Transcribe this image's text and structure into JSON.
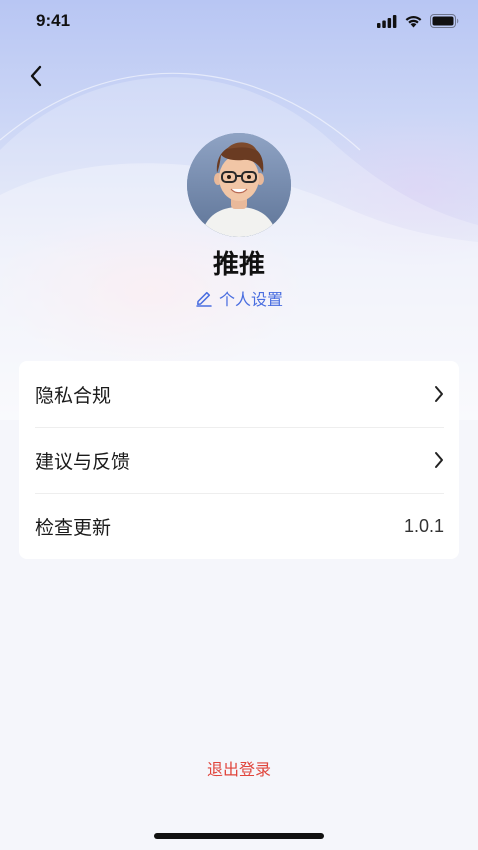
{
  "status_bar": {
    "time": "9:41",
    "icons": [
      "cellular-signal-icon",
      "wifi-icon",
      "battery-icon"
    ]
  },
  "header": {
    "back_icon": "chevron-left-icon"
  },
  "profile": {
    "nickname": "推推",
    "settings_link_label": "个人设置",
    "settings_link_icon": "pencil-edit-icon",
    "accent_color": "#4a6ee0"
  },
  "menu": {
    "items": [
      {
        "label": "隐私合规",
        "trailing_icon": "chevron-right-icon"
      },
      {
        "label": "建议与反馈",
        "trailing_icon": "chevron-right-icon"
      },
      {
        "label": "检查更新",
        "value": "1.0.1"
      }
    ]
  },
  "footer": {
    "logout_label": "退出登录",
    "logout_color": "#e0453c"
  }
}
